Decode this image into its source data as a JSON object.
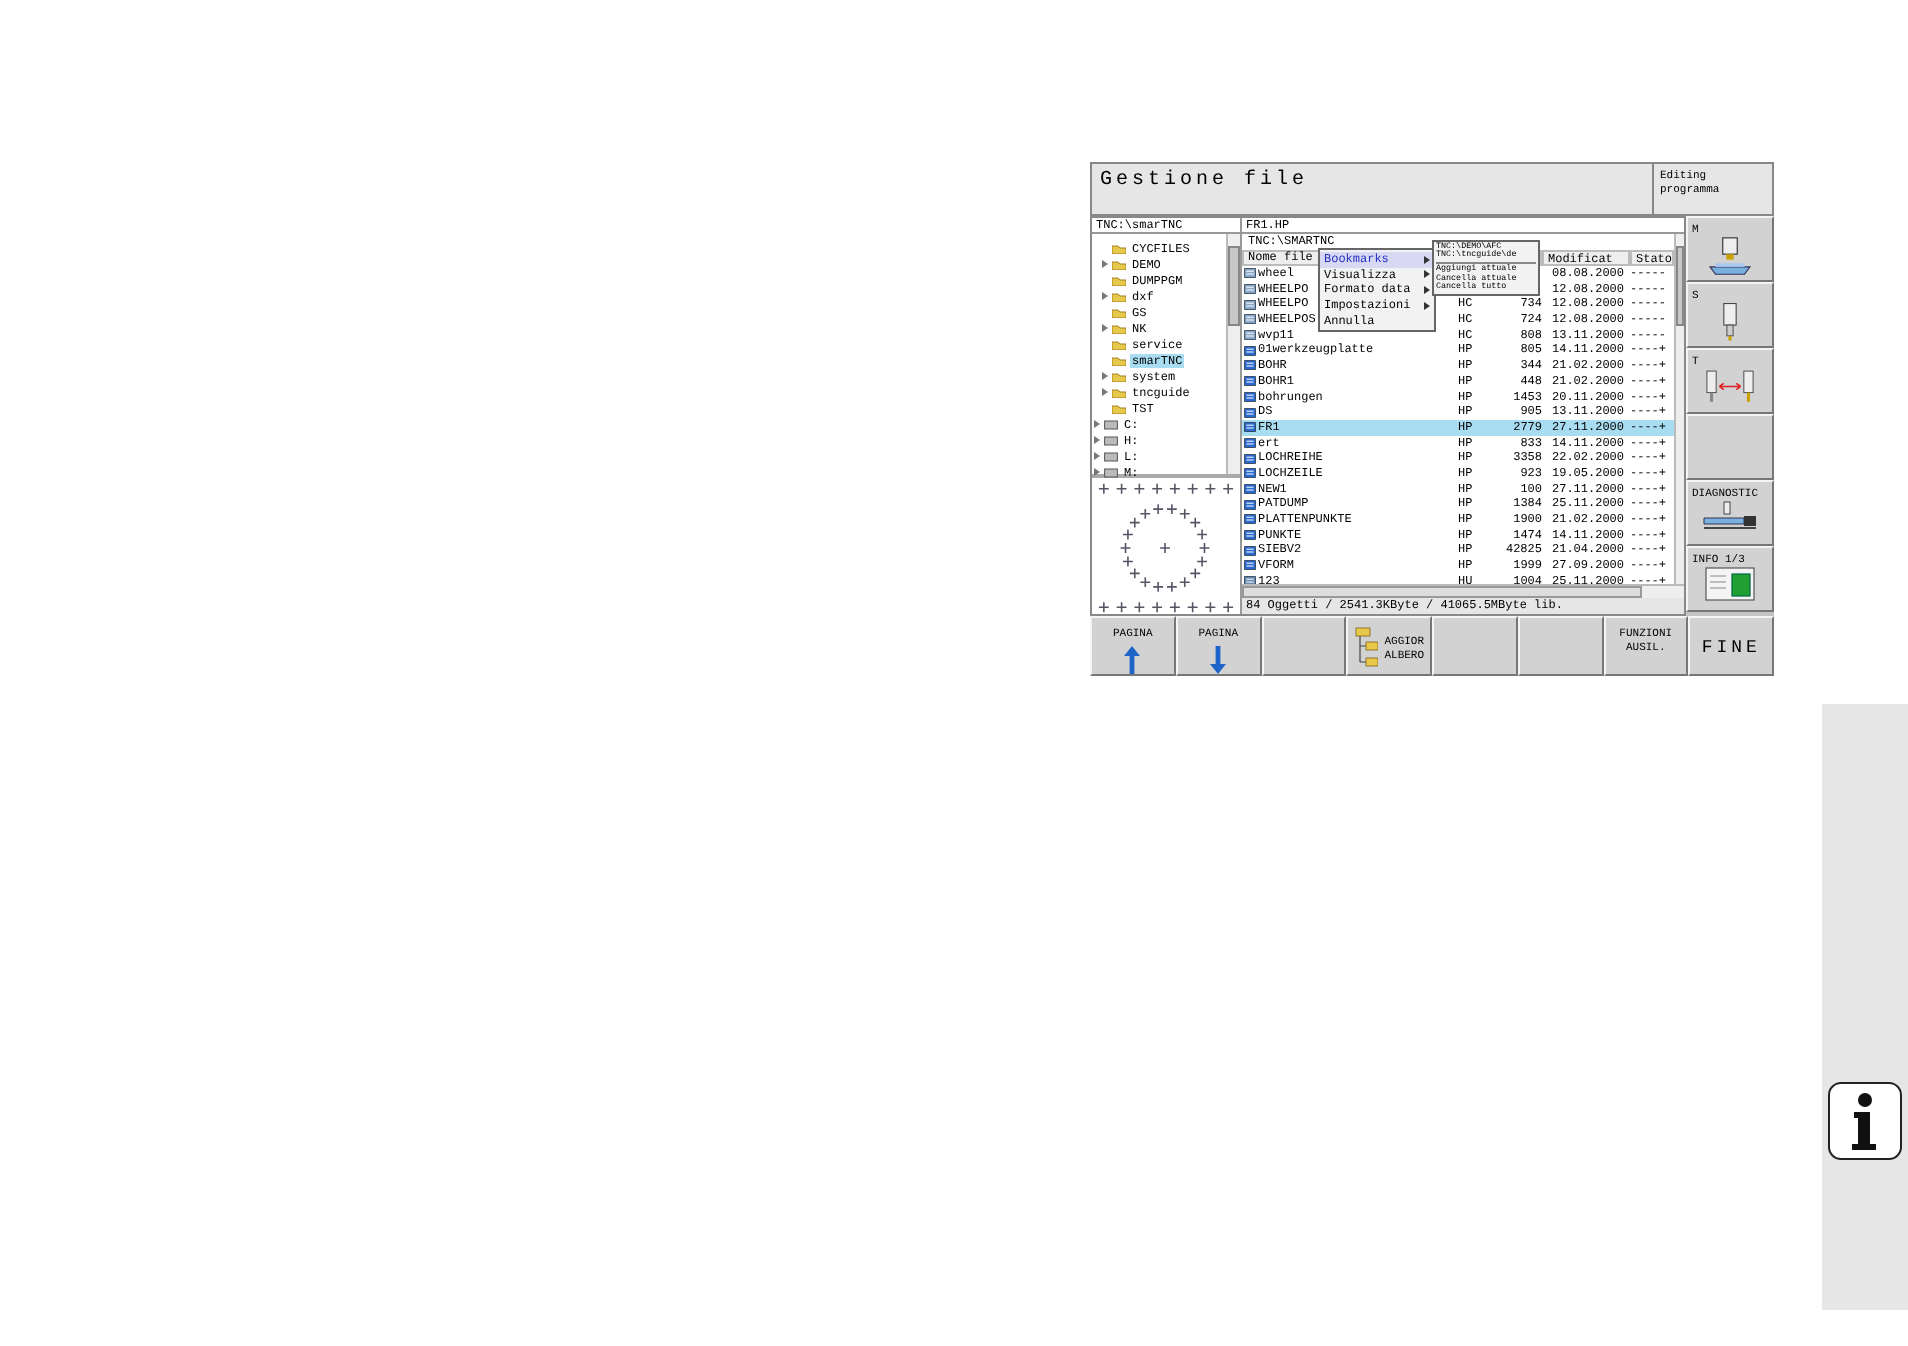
{
  "screen": {
    "title": "Gestione file",
    "mode": "Editing programma",
    "tree_path": "TNC:\\smarTNC",
    "file_path": "FR1.HP",
    "folders": [
      {
        "label": "CYCFILES",
        "expandable": false,
        "selected": false
      },
      {
        "label": "DEMO",
        "expandable": true,
        "selected": false
      },
      {
        "label": "DUMPPGM",
        "expandable": false,
        "selected": false
      },
      {
        "label": "dxf",
        "expandable": true,
        "selected": false
      },
      {
        "label": "GS",
        "expandable": false,
        "selected": false
      },
      {
        "label": "NK",
        "expandable": true,
        "selected": false
      },
      {
        "label": "service",
        "expandable": false,
        "selected": false
      },
      {
        "label": "smarTNC",
        "expandable": false,
        "selected": true
      },
      {
        "label": "system",
        "expandable": true,
        "selected": false
      },
      {
        "label": "tncguide",
        "expandable": true,
        "selected": false
      },
      {
        "label": "TST",
        "expandable": false,
        "selected": false
      }
    ],
    "drives": [
      {
        "label": "C:",
        "expandable": true,
        "selected": false
      },
      {
        "label": "H:",
        "expandable": true,
        "selected": false
      },
      {
        "label": "L:",
        "expandable": true,
        "selected": false
      },
      {
        "label": "M:",
        "expandable": true,
        "selected": false
      }
    ],
    "list_path": "TNC:\\SMARTNC",
    "columns": [
      "Nome file",
      "Modificat",
      "Stato"
    ],
    "rows": [
      {
        "kind": "contour",
        "name": "wheel",
        "modified": "08.08.2000",
        "state": "-----",
        "selected": false
      },
      {
        "kind": "contour",
        "name": "WHEELPO",
        "modified": "12.08.2000",
        "state": "-----",
        "selected": false
      },
      {
        "kind": "contour",
        "name": "WHEELPO",
        "type": "HC",
        "size": "734",
        "modified": "12.08.2000",
        "state": "-----",
        "selected": false
      },
      {
        "kind": "contour",
        "name": "WHEELPOS",
        "type": "HC",
        "size": "724",
        "modified": "12.08.2000",
        "state": "-----",
        "selected": false
      },
      {
        "kind": "contour",
        "name": "wvp11",
        "type": "HC",
        "size": "808",
        "modified": "13.11.2000",
        "state": "-----",
        "selected": false
      },
      {
        "kind": "program",
        "name": "01werkzeugplatte",
        "type": "HP",
        "size": "805",
        "modified": "14.11.2000",
        "state": "----+",
        "selected": false
      },
      {
        "kind": "program",
        "name": "BOHR",
        "type": "HP",
        "size": "344",
        "modified": "21.02.2000",
        "state": "----+",
        "selected": false
      },
      {
        "kind": "program",
        "name": "BOHR1",
        "type": "HP",
        "size": "448",
        "modified": "21.02.2000",
        "state": "----+",
        "selected": false
      },
      {
        "kind": "program",
        "name": "bohrungen",
        "type": "HP",
        "size": "1453",
        "modified": "20.11.2000",
        "state": "----+",
        "selected": false
      },
      {
        "kind": "program",
        "name": "DS",
        "type": "HP",
        "size": "905",
        "modified": "13.11.2000",
        "state": "----+",
        "selected": false
      },
      {
        "kind": "program",
        "name": "FR1",
        "type": "HP",
        "size": "2779",
        "modified": "27.11.2000",
        "state": "----+",
        "selected": true
      },
      {
        "kind": "program",
        "name": "ert",
        "type": "HP",
        "size": "833",
        "modified": "14.11.2000",
        "state": "----+",
        "selected": false
      },
      {
        "kind": "program",
        "name": "LOCHREIHE",
        "type": "HP",
        "size": "3358",
        "modified": "22.02.2000",
        "state": "----+",
        "selected": false
      },
      {
        "kind": "program",
        "name": "LOCHZEILE",
        "type": "HP",
        "size": "923",
        "modified": "19.05.2000",
        "state": "----+",
        "selected": false
      },
      {
        "kind": "program",
        "name": "NEW1",
        "type": "HP",
        "size": "100",
        "modified": "27.11.2000",
        "state": "----+",
        "selected": false
      },
      {
        "kind": "program",
        "name": "PATDUMP",
        "type": "HP",
        "size": "1384",
        "modified": "25.11.2000",
        "state": "----+",
        "selected": false
      },
      {
        "kind": "program",
        "name": "PLATTENPUNKTE",
        "type": "HP",
        "size": "1900",
        "modified": "21.02.2000",
        "state": "----+",
        "selected": false
      },
      {
        "kind": "program",
        "name": "PUNKTE",
        "type": "HP",
        "size": "1474",
        "modified": "14.11.2000",
        "state": "----+",
        "selected": false
      },
      {
        "kind": "program",
        "name": "SIEBV2",
        "type": "HP",
        "size": "42825",
        "modified": "21.04.2000",
        "state": "----+",
        "selected": false
      },
      {
        "kind": "program",
        "name": "VFORM",
        "type": "HP",
        "size": "1999",
        "modified": "27.09.2000",
        "state": "----+",
        "selected": false
      },
      {
        "kind": "other",
        "name": "123",
        "type": "HU",
        "size": "1004",
        "modified": "25.11.2000",
        "state": "----+",
        "selected": false
      }
    ],
    "status": "84 Oggetti / 2541.3KByte / 41065.5MByte lib.",
    "menu": [
      {
        "label": "Bookmarks",
        "has_submenu": true,
        "selected": true
      },
      {
        "label": "Visualizza",
        "has_submenu": true,
        "selected": false
      },
      {
        "label": "Formato data",
        "has_submenu": true,
        "selected": false
      },
      {
        "label": "Impostazioni",
        "has_submenu": true,
        "selected": false
      },
      {
        "label": "Annulla",
        "has_submenu": false,
        "selected": false
      }
    ],
    "submenu_bookmarks": [
      "TNC:\\DEMO\\AFC",
      "TNC:\\tncguide\\de"
    ],
    "submenu_actions": [
      "Aggiungi attuale",
      "Cancella attuale",
      "Cancella tutto"
    ],
    "side_softkeys": [
      {
        "kind": "m-function",
        "label": "M"
      },
      {
        "kind": "s-function",
        "label": "S"
      },
      {
        "kind": "t-function",
        "label": "T"
      },
      {
        "kind": "blank"
      },
      {
        "kind": "diagnostic",
        "label": "DIAGNOSTIC"
      },
      {
        "kind": "info",
        "label": "INFO 1/3"
      }
    ],
    "softkeys": [
      {
        "kind": "page-up",
        "lines": [
          "PAGINA"
        ]
      },
      {
        "kind": "page-down",
        "lines": [
          "PAGINA"
        ]
      },
      {
        "kind": "blank"
      },
      {
        "kind": "tree",
        "lines": [
          "AGGIOR",
          "ALBERO"
        ]
      },
      {
        "kind": "blank"
      },
      {
        "kind": "blank"
      },
      {
        "kind": "text",
        "lines": [
          "FUNZIONI",
          "AUSIL."
        ]
      },
      {
        "kind": "end",
        "lines": [
          "FINE"
        ]
      }
    ]
  }
}
